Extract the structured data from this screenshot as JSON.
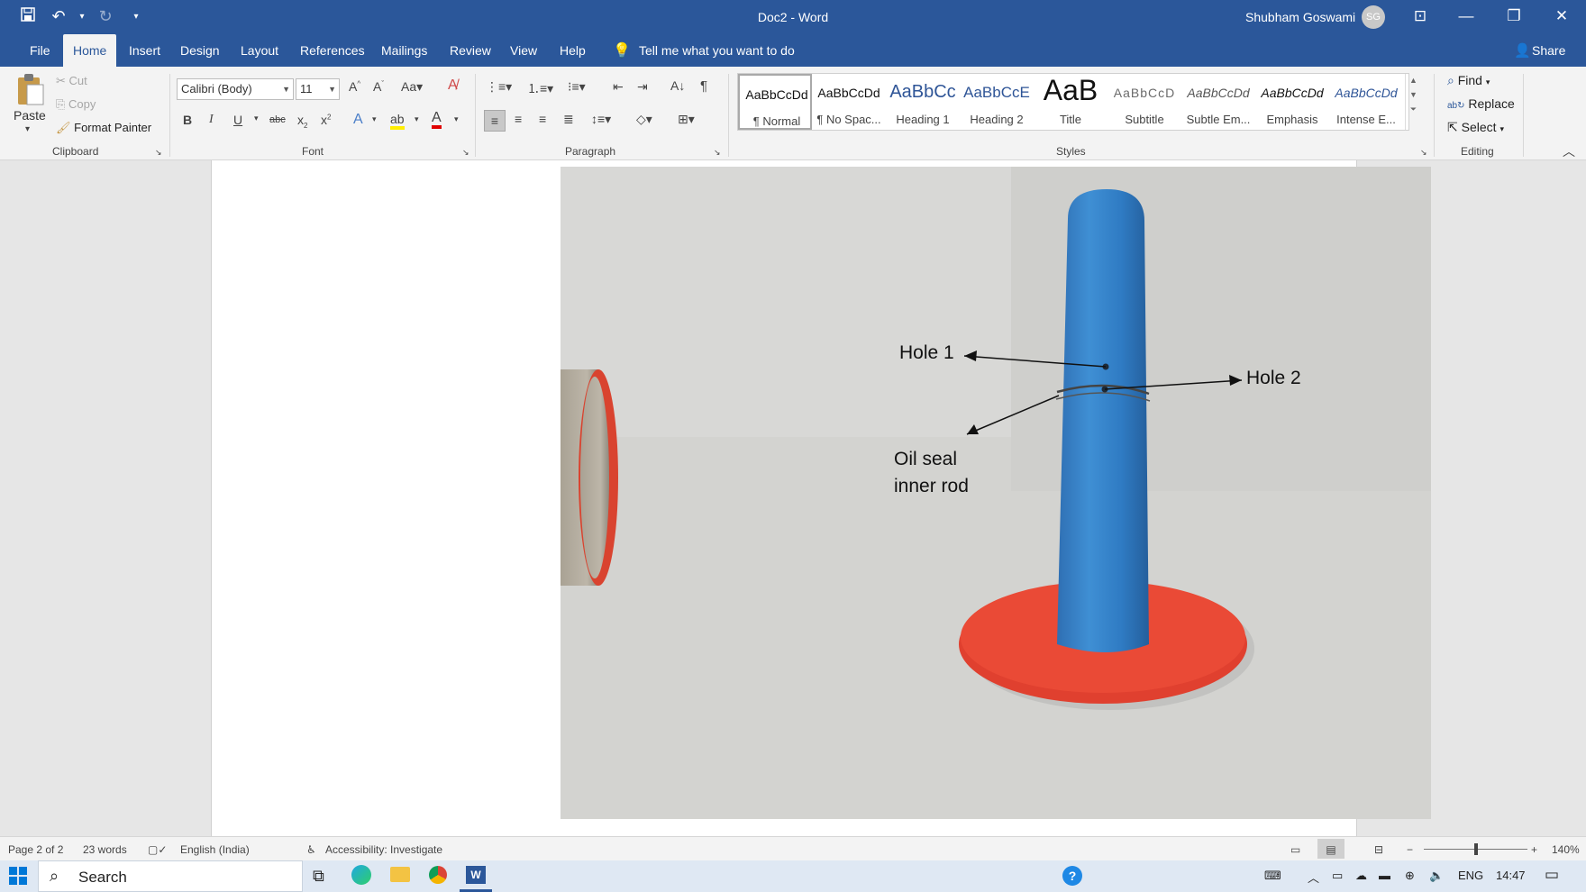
{
  "titlebar": {
    "doc_title": "Doc2  -  Word",
    "user_name": "Shubham Goswami",
    "avatar_initials": "SG"
  },
  "tabs": [
    {
      "label": "File"
    },
    {
      "label": "Home"
    },
    {
      "label": "Insert"
    },
    {
      "label": "Design"
    },
    {
      "label": "Layout"
    },
    {
      "label": "References"
    },
    {
      "label": "Mailings"
    },
    {
      "label": "Review"
    },
    {
      "label": "View"
    },
    {
      "label": "Help"
    }
  ],
  "tell_me": "Tell me what you want to do",
  "share": "Share",
  "clipboard": {
    "paste": "Paste",
    "cut": "Cut",
    "copy": "Copy",
    "format_painter": "Format Painter",
    "group": "Clipboard"
  },
  "font": {
    "name": "Calibri (Body)",
    "size": "11",
    "group": "Font"
  },
  "paragraph": {
    "group": "Paragraph"
  },
  "styles": {
    "group": "Styles",
    "items": [
      {
        "preview": "AaBbCcDd",
        "name": "¶ Normal"
      },
      {
        "preview": "AaBbCcDd",
        "name": "¶ No Spac..."
      },
      {
        "preview": "AaBbCc",
        "name": "Heading 1"
      },
      {
        "preview": "AaBbCcE",
        "name": "Heading 2"
      },
      {
        "preview": "AaB",
        "name": "Title"
      },
      {
        "preview": "AaBbCcD",
        "name": "Subtitle"
      },
      {
        "preview": "AaBbCcDd",
        "name": "Subtle Em..."
      },
      {
        "preview": "AaBbCcDd",
        "name": "Emphasis"
      },
      {
        "preview": "AaBbCcDd",
        "name": "Intense E..."
      }
    ]
  },
  "editing": {
    "find": "Find",
    "replace": "Replace",
    "select": "Select",
    "group": "Editing"
  },
  "annotations": {
    "hole1": "Hole 1",
    "hole2": "Hole 2",
    "oil_seal_l1": "Oil seal",
    "oil_seal_l2": "inner rod"
  },
  "status": {
    "page": "Page 2 of 2",
    "words": "23 words",
    "language": "English (India)",
    "accessibility": "Accessibility: Investigate",
    "zoom": "140%"
  },
  "taskbar": {
    "search": "Search",
    "lang": "ENG",
    "time": "14:47"
  }
}
